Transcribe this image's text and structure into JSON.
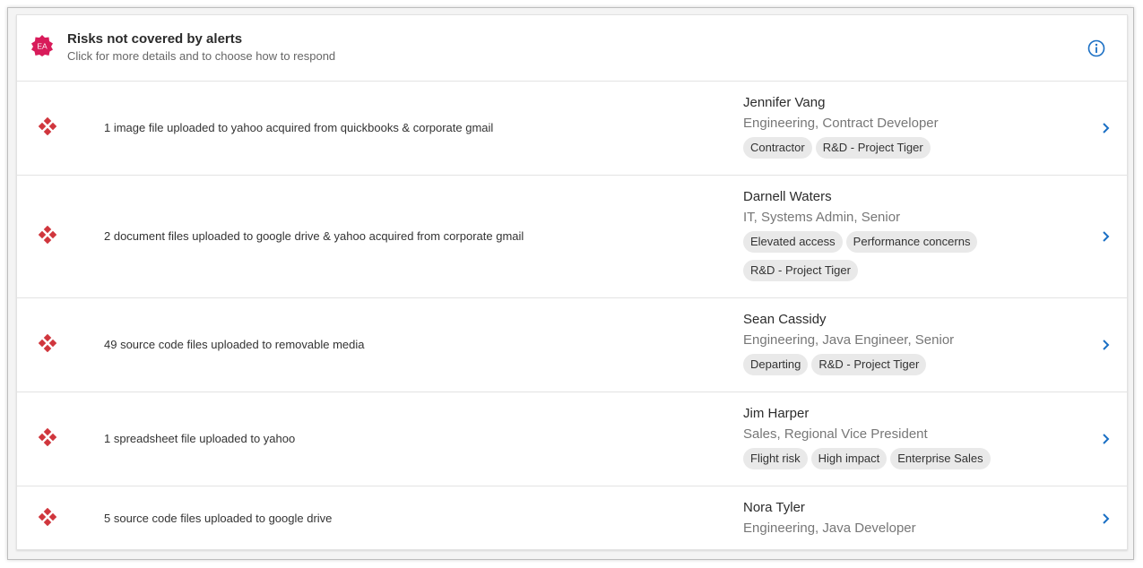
{
  "header": {
    "badge_text": "EA",
    "title": "Risks not covered by alerts",
    "subtitle": "Click for more details and to choose how to respond",
    "info_icon": "info-icon"
  },
  "colors": {
    "accent_blue": "#1a6fc4",
    "risk_red": "#d0363d",
    "badge_magenta": "#d81b5a"
  },
  "rows": [
    {
      "description": "1 image file uploaded to yahoo acquired from quickbooks & corporate gmail",
      "name": "Jennifer Vang",
      "role": "Engineering, Contract Developer",
      "tags": [
        "Contractor",
        "R&D - Project Tiger"
      ]
    },
    {
      "description": "2 document files uploaded to google drive & yahoo acquired from corporate gmail",
      "name": "Darnell Waters",
      "role": "IT, Systems Admin, Senior",
      "tags": [
        "Elevated access",
        "Performance concerns",
        "R&D - Project Tiger"
      ]
    },
    {
      "description": "49 source code files uploaded to removable media",
      "name": "Sean Cassidy",
      "role": "Engineering, Java Engineer, Senior",
      "tags": [
        "Departing",
        "R&D - Project Tiger"
      ]
    },
    {
      "description": "1 spreadsheet file uploaded to yahoo",
      "name": "Jim Harper",
      "role": "Sales, Regional Vice President",
      "tags": [
        "Flight risk",
        "High impact",
        "Enterprise Sales"
      ]
    },
    {
      "description": "5 source code files uploaded to google drive",
      "name": "Nora Tyler",
      "role": "Engineering, Java Developer",
      "tags": []
    }
  ]
}
